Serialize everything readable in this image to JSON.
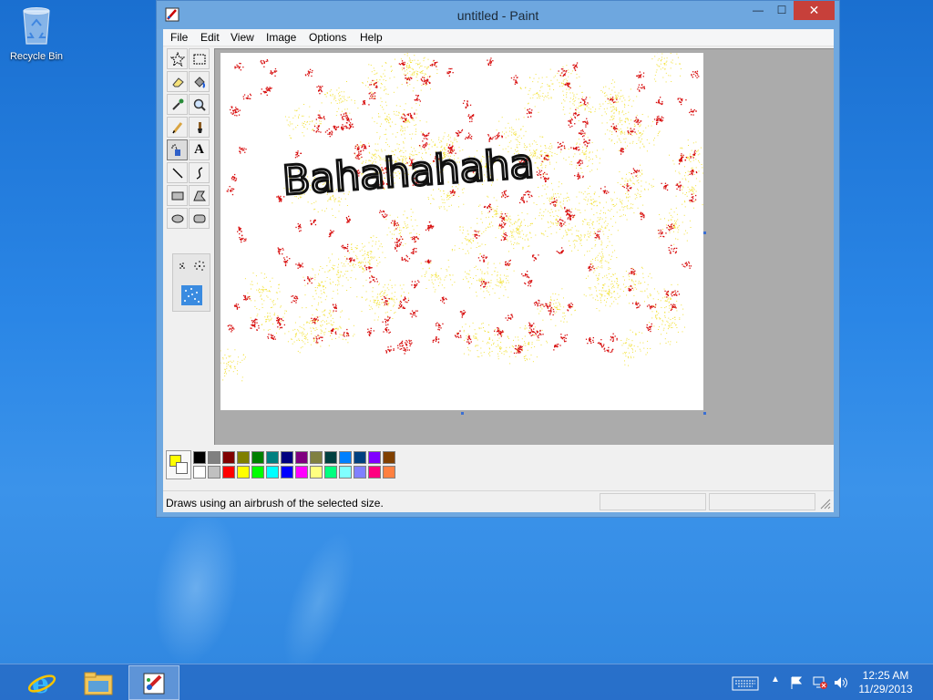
{
  "desktop": {
    "recycle_bin_label": "Recycle Bin"
  },
  "window": {
    "title": "untitled - Paint",
    "minimize_glyph": "—",
    "maximize_glyph": "☐",
    "close_glyph": "✕"
  },
  "menu": {
    "items": [
      "File",
      "Edit",
      "View",
      "Image",
      "Options",
      "Help"
    ]
  },
  "tools": [
    {
      "name": "free-form-select",
      "icon": "star-select-icon"
    },
    {
      "name": "select",
      "icon": "rect-select-icon"
    },
    {
      "name": "eraser",
      "icon": "eraser-icon"
    },
    {
      "name": "fill",
      "icon": "paint-bucket-icon"
    },
    {
      "name": "pick-color",
      "icon": "eyedropper-icon"
    },
    {
      "name": "magnifier",
      "icon": "magnifier-icon"
    },
    {
      "name": "pencil",
      "icon": "pencil-icon"
    },
    {
      "name": "brush",
      "icon": "brush-icon"
    },
    {
      "name": "airbrush",
      "icon": "airbrush-icon",
      "active": true
    },
    {
      "name": "text",
      "icon": "text-icon",
      "label": "A"
    },
    {
      "name": "line",
      "icon": "line-icon"
    },
    {
      "name": "curve",
      "icon": "curve-icon"
    },
    {
      "name": "rectangle",
      "icon": "rectangle-icon"
    },
    {
      "name": "polygon",
      "icon": "polygon-icon"
    },
    {
      "name": "ellipse",
      "icon": "ellipse-icon"
    },
    {
      "name": "rounded-rectangle",
      "icon": "rounded-rect-icon"
    }
  ],
  "canvas": {
    "text": "Bahahahaha"
  },
  "colors": {
    "foreground": "#ffff00",
    "background": "#ffffff",
    "palette_top": [
      "#000000",
      "#808080",
      "#800000",
      "#808000",
      "#008000",
      "#008080",
      "#000080",
      "#800080",
      "#808040",
      "#004040",
      "#0080ff",
      "#004080",
      "#8000ff",
      "#804000"
    ],
    "palette_bottom": [
      "#ffffff",
      "#c0c0c0",
      "#ff0000",
      "#ffff00",
      "#00ff00",
      "#00ffff",
      "#0000ff",
      "#ff00ff",
      "#ffff80",
      "#00ff80",
      "#80ffff",
      "#8080ff",
      "#ff0080",
      "#ff8040"
    ]
  },
  "status": {
    "text": "Draws using an airbrush of the selected size."
  },
  "taskbar": {
    "time": "12:25 AM",
    "date": "11/29/2013"
  }
}
